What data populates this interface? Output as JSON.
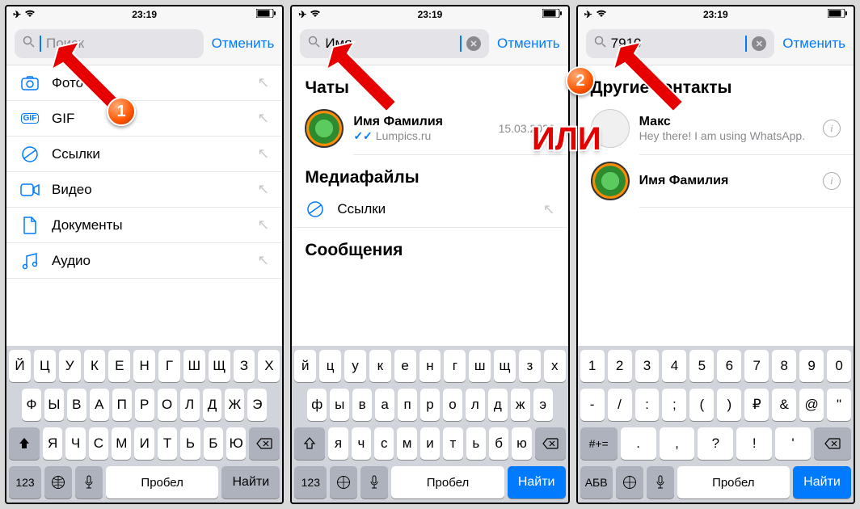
{
  "status": {
    "time": "23:19"
  },
  "cancel": "Отменить",
  "screens": [
    {
      "search": {
        "placeholder": "Поиск",
        "value": ""
      },
      "categories": [
        {
          "icon": "photo",
          "label": "Фото"
        },
        {
          "icon": "gif",
          "label": "GIF"
        },
        {
          "icon": "link",
          "label": "Ссылки"
        },
        {
          "icon": "video",
          "label": "Видео"
        },
        {
          "icon": "doc",
          "label": "Документы"
        },
        {
          "icon": "audio",
          "label": "Аудио"
        }
      ]
    },
    {
      "search": {
        "value": "Имя"
      },
      "sections": {
        "chats": "Чаты",
        "media": "Медиафайлы",
        "messages": "Сообщения",
        "links_label": "Ссылки"
      },
      "chat": {
        "name": "Имя Фамилия",
        "sub": "Lumpics.ru",
        "date": "15.03.2020"
      }
    },
    {
      "search": {
        "value": "7910"
      },
      "section": "Другие контакты",
      "contacts": [
        {
          "name": "Макс",
          "status": "Hey there! I am using WhatsApp."
        },
        {
          "name": "Имя Фамилия",
          "status": ""
        }
      ]
    }
  ],
  "keyboard": {
    "row1_up": [
      "Й",
      "Ц",
      "У",
      "К",
      "Е",
      "Н",
      "Г",
      "Ш",
      "Щ",
      "З",
      "Х"
    ],
    "row2_up": [
      "Ф",
      "Ы",
      "В",
      "А",
      "П",
      "Р",
      "О",
      "Л",
      "Д",
      "Ж",
      "Э"
    ],
    "row3_up": [
      "Я",
      "Ч",
      "С",
      "М",
      "И",
      "Т",
      "Ь",
      "Б",
      "Ю"
    ],
    "row1_lo": [
      "й",
      "ц",
      "у",
      "к",
      "е",
      "н",
      "г",
      "ш",
      "щ",
      "з",
      "х"
    ],
    "row2_lo": [
      "ф",
      "ы",
      "в",
      "а",
      "п",
      "р",
      "о",
      "л",
      "д",
      "ж",
      "э"
    ],
    "row3_lo": [
      "я",
      "ч",
      "с",
      "м",
      "и",
      "т",
      "ь",
      "б",
      "ю"
    ],
    "num_row1": [
      "1",
      "2",
      "3",
      "4",
      "5",
      "6",
      "7",
      "8",
      "9",
      "0"
    ],
    "num_row2": [
      "-",
      "/",
      ":",
      ";",
      "(",
      ")",
      "₽",
      "&",
      "@",
      "\""
    ],
    "num_row3": [
      ".",
      ",",
      "?",
      "!",
      "'"
    ],
    "space": "Пробел",
    "find": "Найти",
    "mode123": "123",
    "modeABV": "АБВ",
    "modeAlt": "#+="
  },
  "annotations": {
    "badge1": "1",
    "badge2": "2",
    "or": "ИЛИ"
  }
}
